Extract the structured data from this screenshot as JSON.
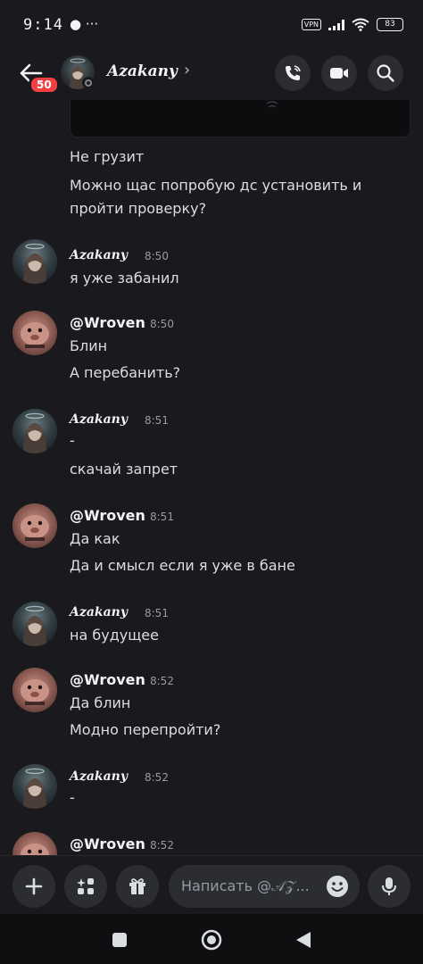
{
  "status_bar": {
    "time": "9:14",
    "left_icons": "● ···",
    "vpn": "VPN",
    "battery": "83"
  },
  "header": {
    "unread_count": "50",
    "channel_name": "Azakany",
    "chevron": "›"
  },
  "messages": {
    "top_lines": [
      "Не грузит",
      "Можно щас попробую дс установить и",
      "пройти проверку?"
    ],
    "groups": [
      {
        "author": "Azakany",
        "time": "8:50",
        "lines": [
          "я уже забанил"
        ]
      },
      {
        "author": "@Wroven",
        "time": "8:50",
        "lines": [
          "Блин",
          "А перебанить?"
        ]
      },
      {
        "author": "Azakany",
        "time": "8:51",
        "lines": [
          "-",
          "скачай запрет"
        ]
      },
      {
        "author": "@Wroven",
        "time": "8:51",
        "lines": [
          "Да как",
          "Да и смысл если я уже в бане"
        ]
      },
      {
        "author": "Azakany",
        "time": "8:51",
        "lines": [
          "на будущее"
        ]
      },
      {
        "author": "@Wroven",
        "time": "8:52",
        "lines": [
          "Да блин",
          "Модно перепройти?"
        ]
      },
      {
        "author": "Azakany",
        "time": "8:52",
        "lines": [
          "-"
        ]
      },
      {
        "author": "@Wroven",
        "time": "8:52",
        "lines": []
      }
    ]
  },
  "composer": {
    "placeholder": "Написать @𝒜𝒵..."
  },
  "icons": {
    "back": "arrow-left-icon",
    "call": "phone-call-icon",
    "video": "video-camera-icon",
    "search": "search-icon",
    "add": "plus-icon",
    "apps": "apps-sparkle-icon",
    "gift": "gift-icon",
    "emoji": "emoji-icon",
    "mic": "microphone-icon"
  },
  "colors": {
    "background": "#1a1a1e",
    "badge": "#f23f43",
    "text": "#dbdee1",
    "muted": "#949ba4"
  }
}
